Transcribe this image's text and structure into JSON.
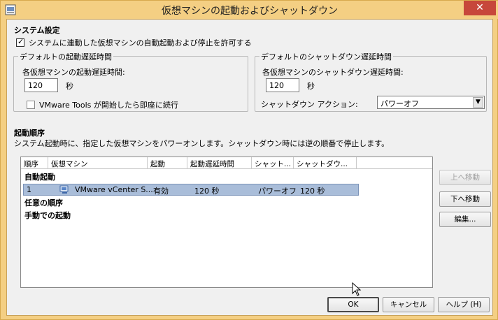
{
  "window": {
    "title": "仮想マシンの起動およびシャットダウン",
    "close_glyph": "✕"
  },
  "system": {
    "section_title": "システム設定",
    "allow_label": "システムに連動した仮想マシンの自動起動および停止を許可する",
    "allow_checked": true
  },
  "startup_delay": {
    "legend": "デフォルトの起動遅延時間",
    "label": "各仮想マシンの起動遅延時間:",
    "value": "120",
    "unit": "秒",
    "tools_label": "VMware Tools が開始したら即座に続行",
    "tools_checked": false
  },
  "shutdown_delay": {
    "legend": "デフォルトのシャットダウン遅延時間",
    "label": "各仮想マシンのシャットダウン遅延時間:",
    "value": "120",
    "unit": "秒",
    "action_label": "シャットダウン アクション:",
    "action_value": "パワーオフ"
  },
  "order": {
    "section_title": "起動順序",
    "description": "システム起動時に、指定した仮想マシンをパワーオンします。シャットダウン時には逆の順番で停止します。",
    "columns": [
      "順序",
      "仮想マシン",
      "起動",
      "起動遅延時間",
      "シャット...",
      "シャットダウ..."
    ],
    "groups": [
      "自動起動",
      "任意の順序",
      "手動での起動"
    ],
    "rows": [
      {
        "order": "1",
        "vm": "VMware vCenter S...",
        "startup": "有効",
        "startup_delay": "120 秒",
        "shutdown": "パワーオフ",
        "shutdown_delay": "120 秒"
      }
    ]
  },
  "side_buttons": {
    "move_up": "上へ移動",
    "move_down": "下へ移動",
    "edit": "編集..."
  },
  "footer_buttons": {
    "ok": "OK",
    "cancel": "キャンセル",
    "help": "ヘルプ (H)"
  },
  "icons": {
    "app": "vsphere-app-icon",
    "vm": "virtual-machine-icon",
    "close": "close-icon",
    "dropdown": "chevron-down-icon",
    "cursor": "mouse-pointer-icon"
  },
  "colors": {
    "title_bar": "#f4cf83",
    "close_button": "#c7473b",
    "selected_row": "#a9bdd9"
  }
}
